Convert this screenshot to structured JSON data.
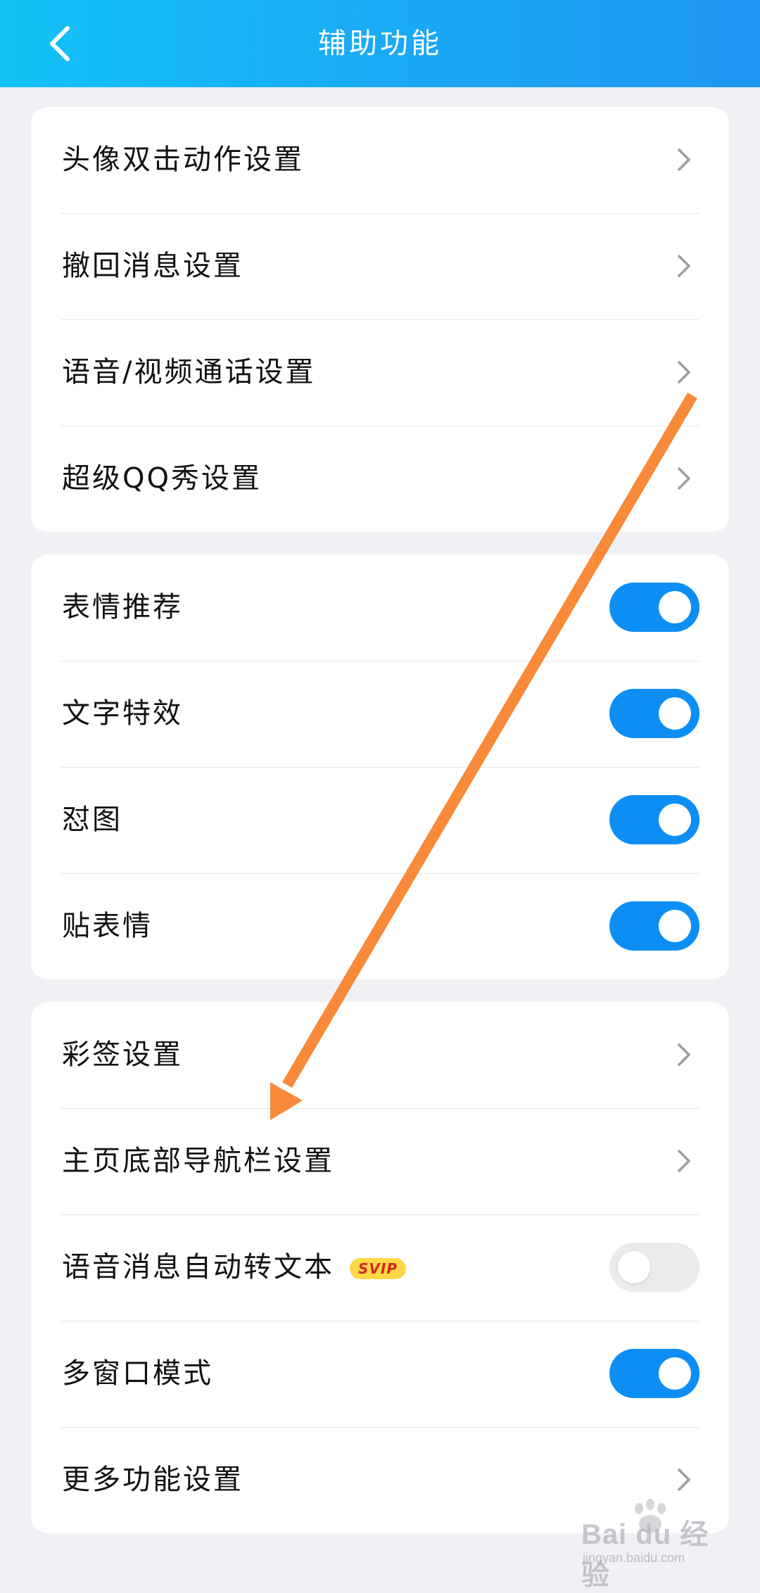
{
  "header": {
    "title": "辅助功能"
  },
  "groups": [
    {
      "rows": [
        {
          "label": "头像双击动作设置",
          "control": "chevron"
        },
        {
          "label": "撤回消息设置",
          "control": "chevron"
        },
        {
          "label": "语音/视频通话设置",
          "control": "chevron"
        },
        {
          "label": "超级QQ秀设置",
          "control": "chevron"
        }
      ]
    },
    {
      "rows": [
        {
          "label": "表情推荐",
          "control": "toggle",
          "on": true
        },
        {
          "label": "文字特效",
          "control": "toggle",
          "on": true
        },
        {
          "label": "怼图",
          "control": "toggle",
          "on": true
        },
        {
          "label": "贴表情",
          "control": "toggle",
          "on": true
        }
      ]
    },
    {
      "rows": [
        {
          "label": "彩签设置",
          "control": "chevron"
        },
        {
          "label": "主页底部导航栏设置",
          "control": "chevron"
        },
        {
          "label": "语音消息自动转文本",
          "badge": "SVIP",
          "control": "toggle",
          "on": false
        },
        {
          "label": "多窗口模式",
          "control": "toggle",
          "on": true
        },
        {
          "label": "更多功能设置",
          "control": "chevron"
        }
      ]
    }
  ],
  "watermark": {
    "text": "Bai du 经验",
    "sub": "jingyan.baidu.com"
  },
  "colors": {
    "accent": "#0c8ef5",
    "header_start": "#12c2f6",
    "header_end": "#1e96f4",
    "annotation_arrow": "#f98a3a",
    "badge_bg": "#ffd747",
    "badge_text": "#d0281e"
  },
  "icons": {
    "back": "chevron-left-icon",
    "row_arrow": "chevron-right-icon"
  }
}
